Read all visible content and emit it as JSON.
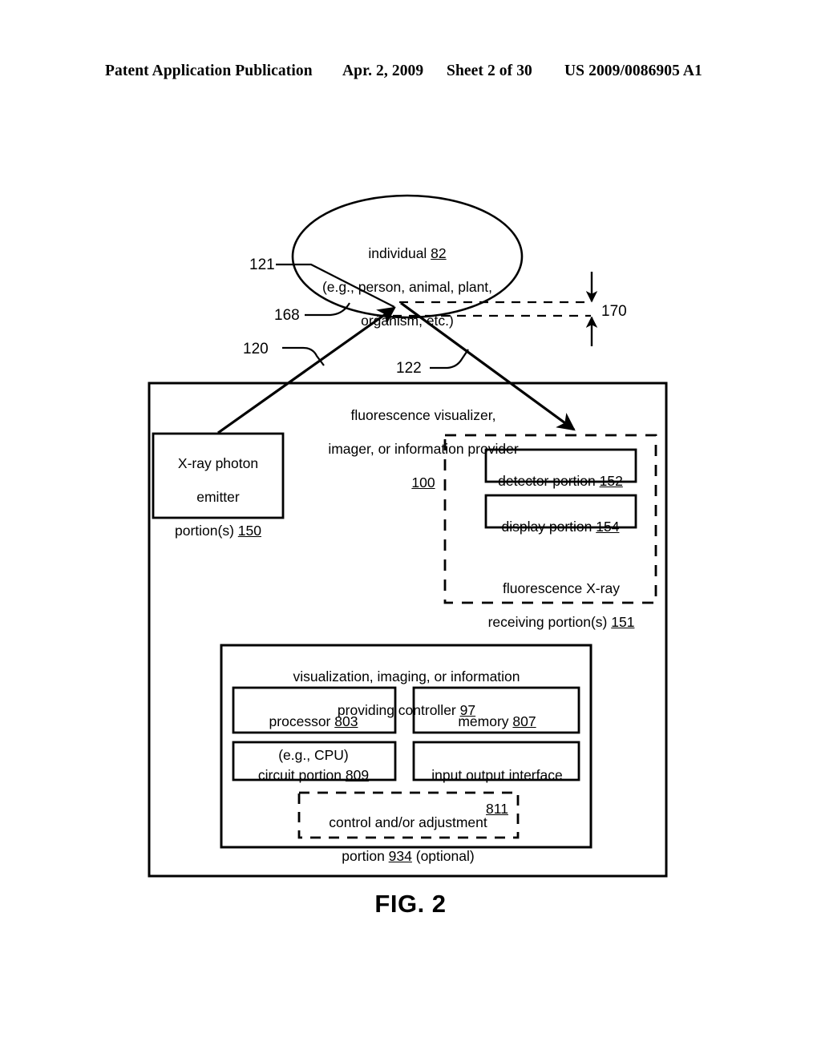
{
  "header": {
    "publication": "Patent Application Publication",
    "date": "Apr. 2, 2009",
    "sheet": "Sheet 2 of 30",
    "patent_number": "US 2009/0086905 A1"
  },
  "figure": {
    "caption": "FIG. 2"
  },
  "diagram": {
    "subject_ellipse": {
      "line1": "individual ",
      "line1_ref": "82",
      "line2": "(e.g., person, animal, plant,",
      "line3": "organism, etc.)"
    },
    "reference_numerals": {
      "n121": "121",
      "n168": "168",
      "n120": "120",
      "n122": "122",
      "n170": "170"
    },
    "system": {
      "line1": "fluorescence visualizer,",
      "line2": "imager, or information provider",
      "ref": "100"
    },
    "emitter": {
      "line1": "X-ray photon",
      "line2": "emitter",
      "line3": "portion(s) ",
      "ref": "150"
    },
    "detector": {
      "label": "detector portion ",
      "ref": "152"
    },
    "display": {
      "label": "display portion ",
      "ref": "154"
    },
    "receiving": {
      "line1": "fluorescence X-ray",
      "line2": "receiving portion(s) ",
      "ref": "151"
    },
    "controller": {
      "line1": "visualization, imaging, or information",
      "line2": "providing controller ",
      "ref": "97"
    },
    "processor": {
      "line1": "processor ",
      "ref": "803",
      "line2": "(e.g., CPU)"
    },
    "memory": {
      "label": "memory ",
      "ref": "807"
    },
    "circuit": {
      "label": "circuit portion ",
      "ref": "809"
    },
    "io_interface": {
      "line1": "input output interface",
      "ref": "811"
    },
    "control_adjustment": {
      "line1": "control and/or adjustment",
      "line2_pre": "portion ",
      "ref": "934",
      "line2_post": " (optional)"
    }
  },
  "colors": {
    "ink": "#000000",
    "paper": "#ffffff"
  }
}
